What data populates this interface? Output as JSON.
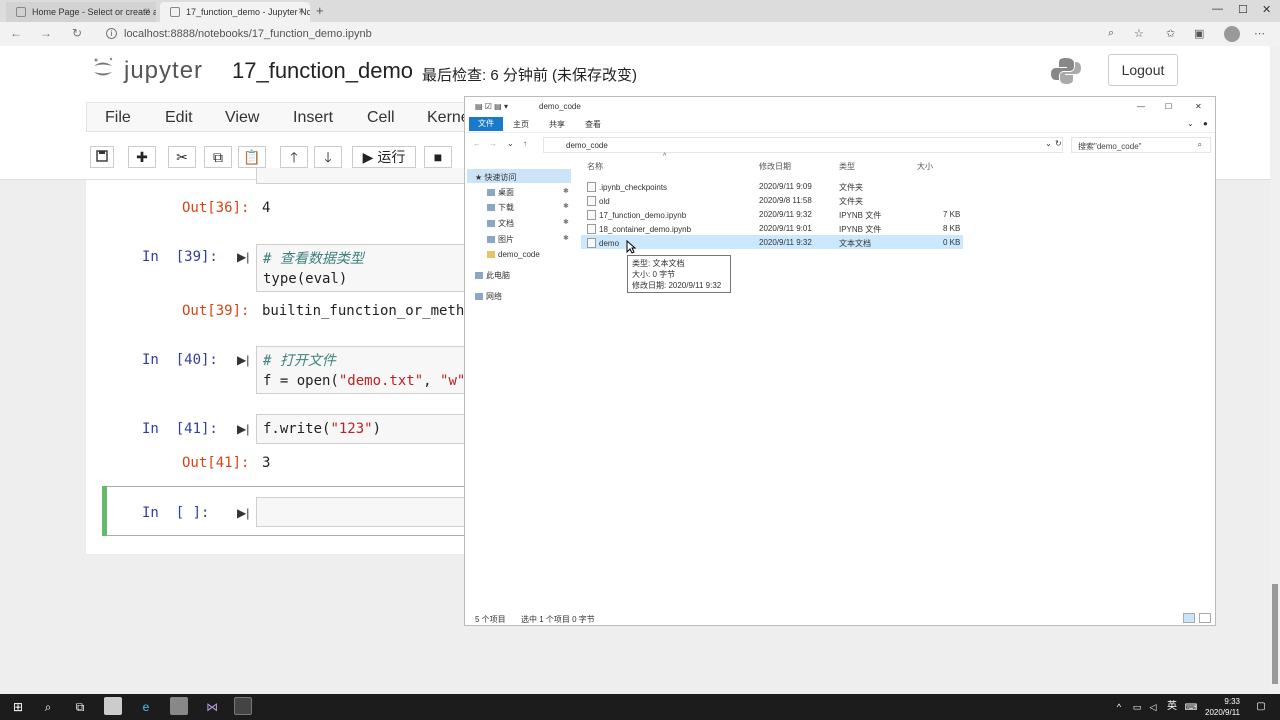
{
  "browser": {
    "tabs": [
      {
        "label": "Home Page - Select or create a..."
      },
      {
        "label": "17_function_demo - Jupyter No..."
      }
    ],
    "url": "localhost:8888/notebooks/17_function_demo.ipynb"
  },
  "jupyter": {
    "logo_text": "jupyter",
    "notebook_title": "17_function_demo",
    "checkpoint_status": "最后检查: 6 分钟前  (未保存改变)",
    "logout_label": "Logout",
    "menu": [
      "File",
      "Edit",
      "View",
      "Insert",
      "Cell",
      "Kernel"
    ],
    "toolbar": {
      "run_label": "运行"
    }
  },
  "cells": [
    {
      "out_prompt": "Out[36]:",
      "output": "4"
    },
    {
      "in_prompt": "In  [39]:",
      "code_comment": "# 查看数据类型",
      "code_line2": "type(eval)",
      "out_prompt": "Out[39]:",
      "output": "builtin_function_or_metho"
    },
    {
      "in_prompt": "In  [40]:",
      "code_comment": "# 打开文件",
      "code_line2_prefix": "f = open(",
      "code_str1": "\"demo.txt\"",
      "code_sep": ", ",
      "code_str2": "\"w\"",
      "code_close": ")"
    },
    {
      "in_prompt": "In  [41]:",
      "code_prefix": "f.write(",
      "code_str": "\"123\"",
      "code_close": ")",
      "out_prompt": "Out[41]:",
      "output": "3"
    },
    {
      "in_prompt": "In  [ ]:"
    }
  ],
  "explorer": {
    "title": "demo_code",
    "ribbon_tabs": [
      "文件",
      "主页",
      "共享",
      "查看"
    ],
    "path": "demo_code",
    "search_placeholder": "搜索\"demo_code\"",
    "nav": {
      "quick_access": "快速访问",
      "items": [
        "桌面",
        "下载",
        "文档",
        "图片",
        "demo_code"
      ],
      "this_pc": "此电脑",
      "network": "网络"
    },
    "columns": {
      "name": "名称",
      "date": "修改日期",
      "type": "类型",
      "size": "大小"
    },
    "files": [
      {
        "name": ".ipynb_checkpoints",
        "date": "2020/9/11 9:09",
        "type": "文件夹",
        "size": ""
      },
      {
        "name": "old",
        "date": "2020/9/8 11:58",
        "type": "文件夹",
        "size": ""
      },
      {
        "name": "17_function_demo.ipynb",
        "date": "2020/9/11 9:32",
        "type": "IPYNB 文件",
        "size": "7 KB"
      },
      {
        "name": "18_container_demo.ipynb",
        "date": "2020/9/11 9:01",
        "type": "IPYNB 文件",
        "size": "8 KB"
      },
      {
        "name": "demo",
        "date": "2020/9/11 9:32",
        "type": "文本文档",
        "size": "0 KB"
      }
    ],
    "tooltip": {
      "type": "类型: 文本文档",
      "size": "大小: 0 字节",
      "date": "修改日期: 2020/9/11 9:32"
    },
    "status_count": "5 个项目",
    "status_selected": "选中 1 个项目  0 字节"
  },
  "taskbar": {
    "time": "9:33",
    "date": "2020/9/11",
    "lang": "英"
  }
}
